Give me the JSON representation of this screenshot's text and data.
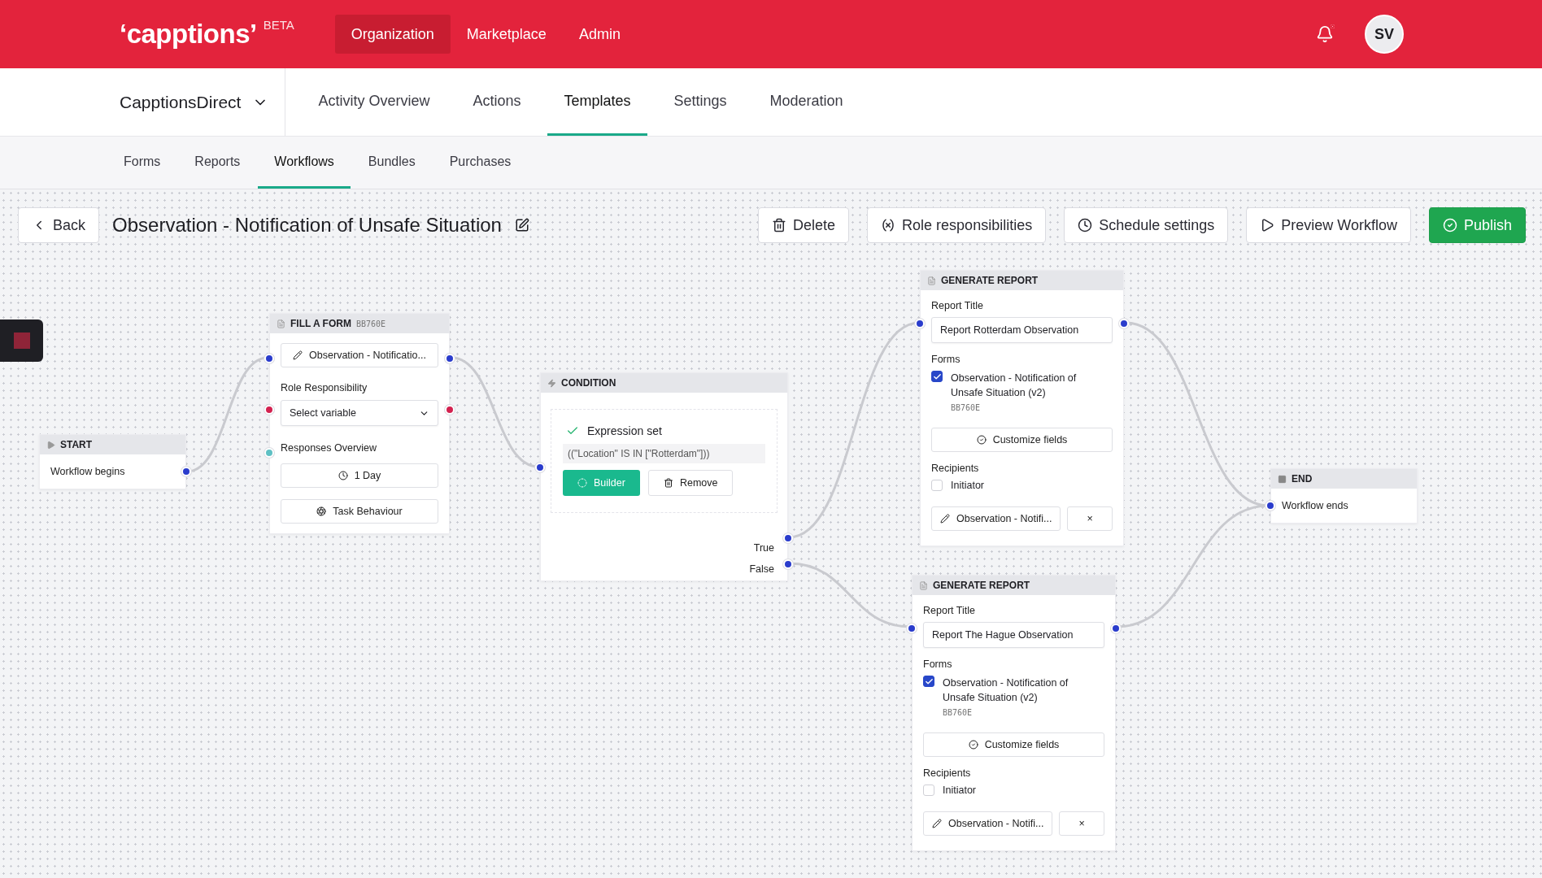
{
  "header": {
    "logo": "‘capptions’",
    "badge": "BETA",
    "nav": [
      {
        "label": "Organization",
        "selected": true
      },
      {
        "label": "Marketplace",
        "selected": false
      },
      {
        "label": "Admin",
        "selected": false
      }
    ],
    "notifications_unread": true,
    "avatar": "SV"
  },
  "org_bar": {
    "organization": "CapptionsDirect",
    "tabs": [
      {
        "label": "Activity Overview",
        "selected": false
      },
      {
        "label": "Actions",
        "selected": false
      },
      {
        "label": "Templates",
        "selected": true
      },
      {
        "label": "Settings",
        "selected": false
      },
      {
        "label": "Moderation",
        "selected": false
      }
    ]
  },
  "sub_tabs": [
    {
      "label": "Forms",
      "selected": false
    },
    {
      "label": "Reports",
      "selected": false
    },
    {
      "label": "Workflows",
      "selected": true
    },
    {
      "label": "Bundles",
      "selected": false
    },
    {
      "label": "Purchases",
      "selected": false
    }
  ],
  "toolbar": {
    "back": "Back",
    "title": "Observation - Notification of Unsafe Situation",
    "actions": [
      {
        "label": "Delete",
        "kind": "delete"
      },
      {
        "label": "Role responsibilities",
        "kind": "roles"
      },
      {
        "label": "Schedule settings",
        "kind": "schedule"
      },
      {
        "label": "Preview Workflow",
        "kind": "preview"
      },
      {
        "label": "Publish",
        "kind": "publish"
      }
    ]
  },
  "nodes": [
    {
      "kind": "start",
      "title": "START",
      "text": "Workflow begins"
    },
    {
      "kind": "fill_form",
      "title": "FILL A FORM",
      "code": "BB760E",
      "form": "Observation - Notificatio...",
      "role_label": "Role Responsibility",
      "role_select": "Select variable",
      "responses_label": "Responses Overview",
      "duration": "1 Day",
      "behaviour": "Task Behaviour"
    },
    {
      "kind": "condition",
      "title": "CONDITION",
      "status": "Expression set",
      "expression": "((\"Location\" IS IN [\"Rotterdam\"]))",
      "builder": "Builder",
      "remove": "Remove",
      "outputs": [
        "True",
        "False"
      ]
    },
    {
      "kind": "report",
      "title": "GENERATE REPORT",
      "title_label": "Report Title",
      "report_title": "Report Rotterdam Observation",
      "forms_label": "Forms",
      "form_option": {
        "label": "Observation - Notification of Unsafe Situation (v2)",
        "code": "BB760E",
        "checked": true
      },
      "customize": "Customize fields",
      "recipients_label": "Recipients",
      "recipient": {
        "label": "Initiator",
        "checked": false
      },
      "form_button": "Observation - Notifi...",
      "remove": "×"
    },
    {
      "kind": "report",
      "title": "GENERATE REPORT",
      "title_label": "Report Title",
      "report_title": "Report The Hague Observation",
      "forms_label": "Forms",
      "form_option": {
        "label": "Observation - Notification of Unsafe Situation (v2)",
        "code": "BB760E",
        "checked": true
      },
      "customize": "Customize fields",
      "recipients_label": "Recipients",
      "recipient": {
        "label": "Initiator",
        "checked": false
      },
      "form_button": "Observation - Notifi...",
      "remove": "×"
    },
    {
      "kind": "end",
      "title": "END",
      "text": "Workflow ends"
    }
  ]
}
